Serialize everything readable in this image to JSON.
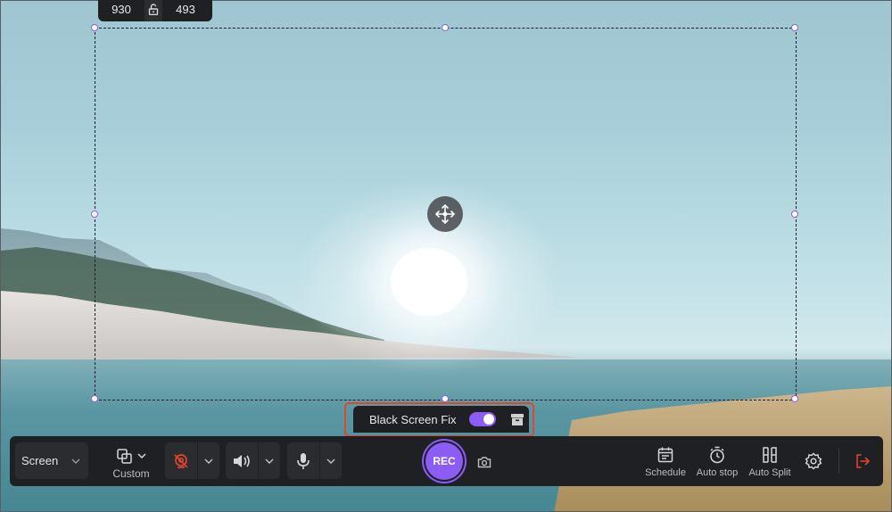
{
  "dimensions": {
    "width": "930",
    "height": "493"
  },
  "black_screen_fix": {
    "label": "Black Screen Fix",
    "enabled": true
  },
  "toolbar": {
    "source": {
      "value": "Screen"
    },
    "region": {
      "label": "Custom"
    },
    "record_label": "REC",
    "schedule_label": "Schedule",
    "auto_stop_label": "Auto stop",
    "auto_split_label": "Auto Split"
  },
  "icons": {
    "lock": "lock-open-icon",
    "move": "move-arrows-icon",
    "webcam": "webcam-off-icon",
    "speaker": "speaker-icon",
    "mic": "microphone-icon",
    "camera": "camera-icon",
    "schedule": "calendar-icon",
    "auto_stop": "stopwatch-icon",
    "auto_split": "split-icon",
    "settings": "gear-icon",
    "exit": "exit-icon"
  },
  "colors": {
    "accent": "#8b5cf6",
    "highlight": "#e0452d",
    "toolbar_bg": "#1f2023"
  }
}
